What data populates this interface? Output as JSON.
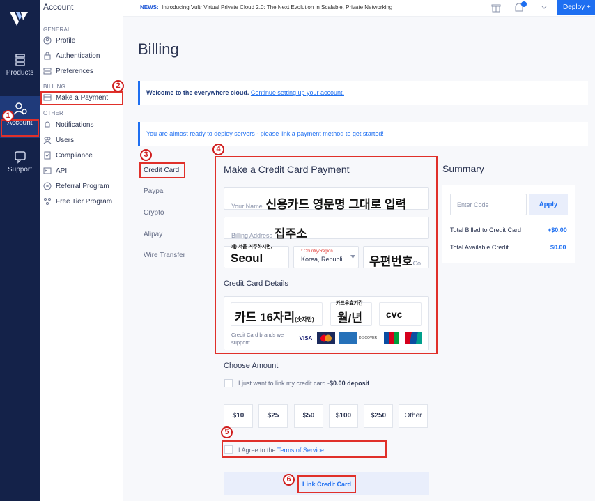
{
  "topbar": {
    "news_label": "NEWS:",
    "news_text": "Introducing Vultr Virtual Private Cloud 2.0: The Next Evolution in Scalable, Private Networking",
    "deploy": "Deploy +"
  },
  "leftnav": {
    "products": "Products",
    "account": "Account",
    "support": "Support"
  },
  "subnav": {
    "title": "Account",
    "general": "GENERAL",
    "billing": "BILLING",
    "other": "OTHER",
    "items": {
      "profile": "Profile",
      "authentication": "Authentication",
      "preferences": "Preferences",
      "make_payment": "Make a Payment",
      "notifications": "Notifications",
      "users": "Users",
      "compliance": "Compliance",
      "api": "API",
      "referral": "Referral Program",
      "free_tier": "Free Tier Program"
    }
  },
  "page": {
    "title": "Billing",
    "welcome_bold": "Welcome to the everywhere cloud.",
    "welcome_link": "Continue setting up your account.",
    "notice": "You are almost ready to deploy servers - please link a payment method to get started!"
  },
  "payment_tabs": [
    "Credit Card",
    "Paypal",
    "Crypto",
    "Alipay",
    "Wire Transfer"
  ],
  "form": {
    "title": "Make a Credit Card Payment",
    "name_ph": "Your Name",
    "name_note": "신용카드 영문명 그대로 입력",
    "addr_ph": "Billing Address",
    "addr_note": "집주소",
    "city_hint": "예) 서울 거주하시면,",
    "city_value": "Seoul",
    "country_label": "* Country/Region",
    "country_value": "Korea, Republi...",
    "zip_note": "우편번호",
    "zip_ph": "Co",
    "cc_details": "Credit Card Details",
    "card_note": "카드 16자리",
    "card_note_small": "(숫자만)",
    "expiry_hint": "카드유효기간",
    "expiry_note": "월/년",
    "cvc_note": "cvc",
    "brands_text": "Credit Card brands we support:",
    "brands": [
      "VISA",
      "MC",
      "AMEX",
      "DISCOVER",
      "JCB",
      "UnionPay"
    ]
  },
  "amount": {
    "title": "Choose Amount",
    "link_only": "I just want to link my credit card -",
    "link_only_bold": "$0.00 deposit",
    "options": [
      "$10",
      "$25",
      "$50",
      "$100",
      "$250",
      "Other"
    ]
  },
  "tos": {
    "prefix": "I Agree to the",
    "link": "Terms of Service"
  },
  "submit": "Link Credit Card",
  "summary": {
    "title": "Summary",
    "code_ph": "Enter Code",
    "apply": "Apply",
    "billed_label": "Total Billed to Credit Card",
    "billed_value": "+$0.00",
    "avail_label": "Total Available Credit",
    "avail_value": "$0.00"
  },
  "annotations": [
    "1",
    "2",
    "3",
    "4",
    "5",
    "6"
  ],
  "colors": {
    "nav": "#142249",
    "accent": "#1e6ff1",
    "annotation": "#e0302a"
  }
}
